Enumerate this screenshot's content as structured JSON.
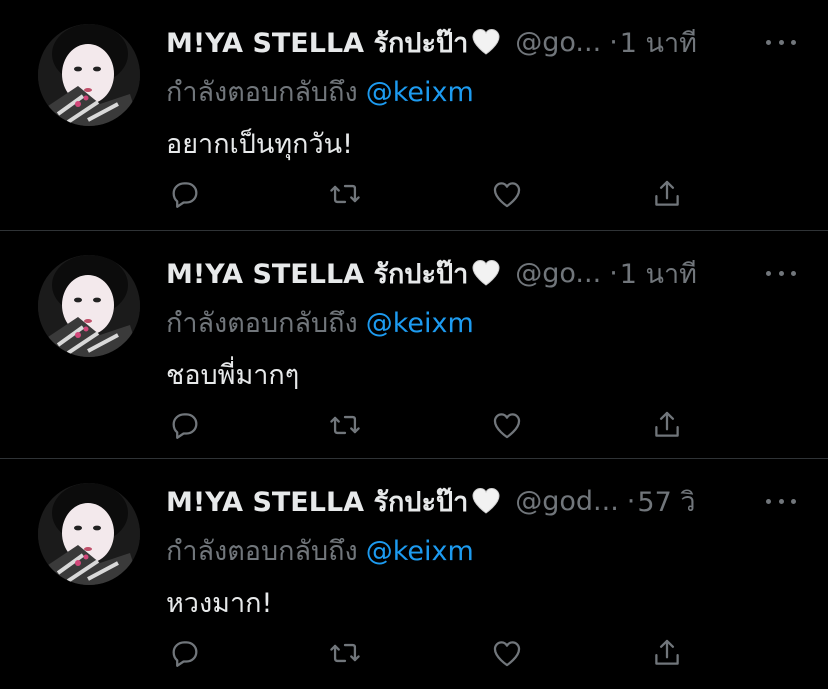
{
  "tweets": [
    {
      "display_name": "M!YA STELLA รักปะป๊า",
      "handle": "@go...",
      "dot": "·",
      "time": "1 นาที",
      "reply_prefix": "กำลังตอบกลับถึง",
      "reply_user": "@keixm",
      "text": "อยากเป็นทุกวัน!"
    },
    {
      "display_name": "M!YA STELLA รักปะป๊า",
      "handle": "@go...",
      "dot": "·",
      "time": "1 นาที",
      "reply_prefix": "กำลังตอบกลับถึง",
      "reply_user": "@keixm",
      "text": "ชอบพี่มากๆ"
    },
    {
      "display_name": "M!YA STELLA รักปะป๊า",
      "handle": "@god...",
      "dot": "·",
      "time": "57 วิ",
      "reply_prefix": "กำลังตอบกลับถึง",
      "reply_user": "@keixm",
      "text": "หวงมาก!"
    }
  ],
  "icons": {
    "reply": "reply-icon",
    "retweet": "retweet-icon",
    "like": "heart-icon",
    "share": "share-icon",
    "more": "more-icon",
    "name_emoji": "white-heart-emoji"
  },
  "colors": {
    "background": "#000000",
    "primary_text": "#e7e9ea",
    "secondary_text": "#71767b",
    "link": "#1d9bf0",
    "divider": "#2f3336"
  }
}
